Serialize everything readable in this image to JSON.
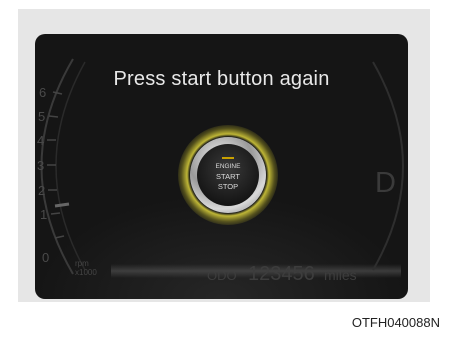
{
  "display": {
    "message": "Press start button again",
    "gear": "D",
    "tachometer": {
      "ticks": [
        "6",
        "5",
        "4",
        "3",
        "2",
        "1",
        "0"
      ],
      "unit_line1": "rpm",
      "unit_line2": "x1000"
    },
    "odometer": {
      "label": "ODO",
      "value": "123456",
      "unit": "miles"
    }
  },
  "button": {
    "line1": "ENGINE",
    "line2": "START",
    "line3": "STOP",
    "glow_color": "#d8d040"
  },
  "figure_code": "OTFH040088N"
}
